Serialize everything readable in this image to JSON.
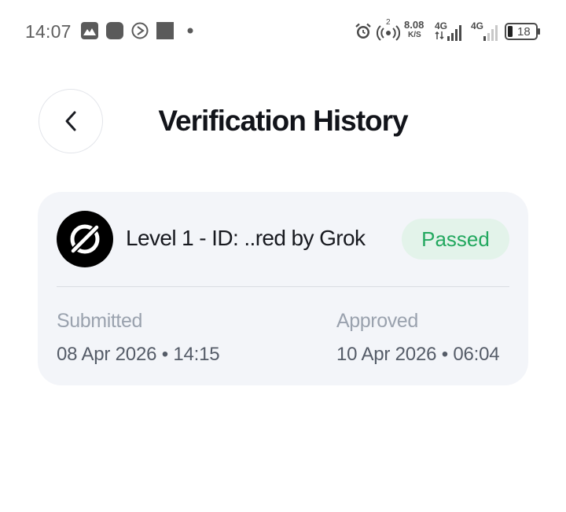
{
  "status_bar": {
    "time": "14:07",
    "left_icons": [
      "gallery-icon",
      "app-square-icon",
      "nav-arrow-icon",
      "stop-square-icon",
      "notification-dot-icon"
    ],
    "hotspot_badge": "2",
    "network_speed_value": "8.08",
    "network_speed_unit": "K/S",
    "sim1_label": "4G",
    "sim2_label": "4G",
    "battery": "18"
  },
  "header": {
    "title": "Verification History"
  },
  "verification": {
    "title": "Level 1 - ID: ..red by Grok",
    "status": "Passed",
    "submitted_label": "Submitted",
    "submitted_value": "08 Apr 2026 • 14:15",
    "approved_label": "Approved",
    "approved_value": "10 Apr 2026 • 06:04"
  },
  "colors": {
    "status_text": "#23a85f",
    "status_bg": "#e3f3ea",
    "card_bg": "#f3f5f9",
    "title": "#12141a"
  }
}
